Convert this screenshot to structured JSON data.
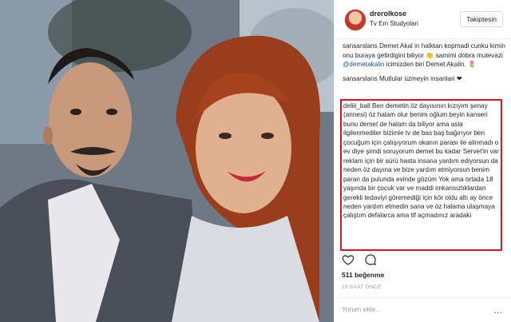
{
  "header": {
    "username": "drerolkose",
    "location": "Tv Em Studyolari",
    "follow_label": "Takiptesin"
  },
  "comments": [
    {
      "user": "sansarslans",
      "text_before": " Demet Akal in halktan kopmadi cunku kimin onu buraya getirdigini biliyor 👏 samimi dobra mutevazi ",
      "mention": "@demetakalin",
      "text_after": " icimizden biri Demet Akalin. 🌷"
    },
    {
      "user": "sansarslans",
      "text_before": " Mutlular üzmeyin insanlari ❤",
      "mention": "",
      "text_after": ""
    }
  ],
  "highlighted_comment": {
    "user": "deliii_ball",
    "text": " Ben demetin öz dayısının kızıyım şenay (annesi) öz halam olur benim oğlum beyin kanseri bunu demet de halam da biliyor ama asla ilgilenmediler bizimle tv de bas baş bağırıyor ben çocuğum için çalışıyorum okanın parası ile alinmadı o ev diye şimdi soruyorum demet bu kadar Servet'in var reklam için bir sürü hasta insana yardım ediyorsun da neden öz dayına ve bize yardım etmiyorsun benim paran da pulunda evinde gözüm Yok ama ortada 18 yaşında bir çocuk var ve maddi imkansızlıklardan gerekli tedaviyi göremediği için kör oldu altı ay önce neden yardım etmedin sana ve öz halama ulaşmaya çalıştım defalarca ama tlf açmadınız aradaki"
  },
  "stats": {
    "likes": "511 beğenme",
    "time": "23 SAAT ÖNCE"
  },
  "footer": {
    "add_comment_placeholder": "Yorum ekle...",
    "more_label": "..."
  },
  "colors": {
    "highlight_border": "#d9171d",
    "mention": "#1d4d8b"
  },
  "icons": [
    "heart-icon",
    "comment-icon"
  ]
}
